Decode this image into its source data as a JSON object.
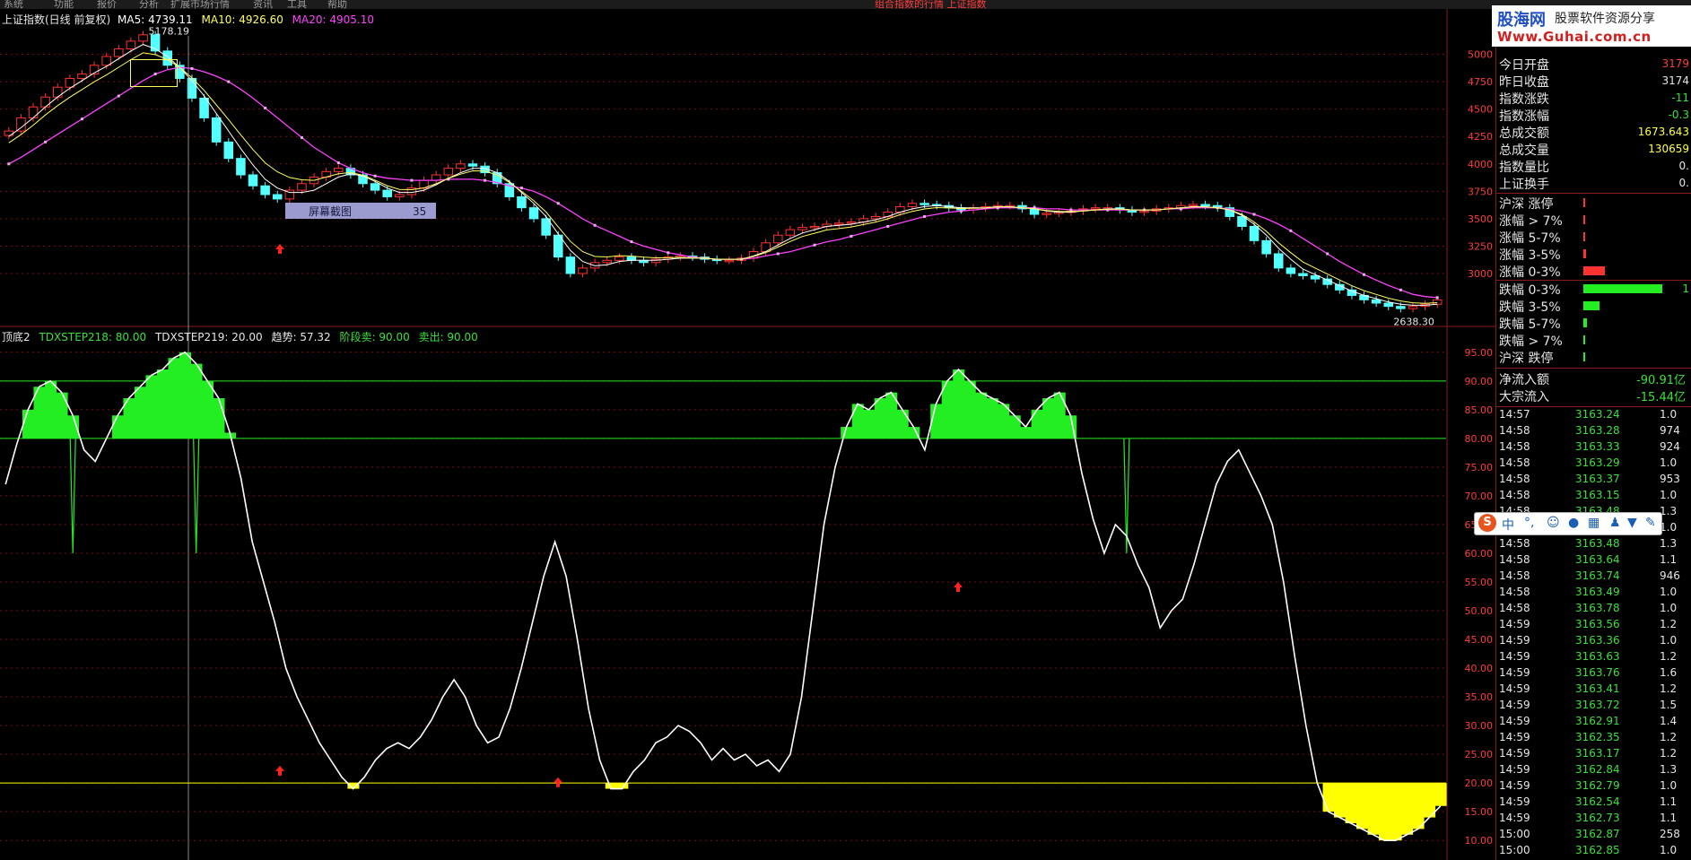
{
  "menu": [
    "系统",
    "功能",
    "报价",
    "分析",
    "扩展市场行情",
    "资讯",
    "工具",
    "帮助"
  ],
  "notice": "组合指数的行情   上证指数",
  "main_info": {
    "title": "上证指数(日线 前复权)",
    "ma5": "MA5: 4739.11",
    "ma10": "MA10: 4926.60",
    "ma20": "MA20: 4905.10",
    "high_label": "5178.19",
    "low_label": "2638.30",
    "overlay_text": "屏幕截图",
    "overlay_num": "35"
  },
  "sub_info": {
    "name": "顶底2",
    "s1": "TDXSTEP218: 80.00",
    "s2": "TDXSTEP219: 20.00",
    "s3": "趋势: 57.32",
    "s4": "阶段卖: 90.00",
    "s5": "卖出: 90.00"
  },
  "colors": {
    "up": "#ff3232",
    "down": "#54ffff",
    "ma5": "#ffffff",
    "ma10": "#ffff60",
    "ma20": "#ff40ff",
    "green": "#22ee22",
    "yellow": "#ffff00",
    "grid": "#7a0c0c"
  },
  "chart_data": [
    {
      "type": "line",
      "name": "上证指数 日线",
      "yticks": [
        3000,
        3250,
        3500,
        3750,
        4000,
        4250,
        4500,
        4750,
        5000
      ],
      "ylim": [
        2550,
        5250
      ],
      "series": [
        {
          "name": "close",
          "values": [
            4300,
            4420,
            4520,
            4610,
            4700,
            4780,
            4820,
            4900,
            4980,
            5050,
            5120,
            5178,
            5030,
            4900,
            4780,
            4600,
            4420,
            4200,
            4050,
            3900,
            3800,
            3720,
            3680,
            3760,
            3820,
            3880,
            3930,
            3960,
            3900,
            3820,
            3760,
            3700,
            3720,
            3780,
            3850,
            3900,
            3960,
            4000,
            3980,
            3920,
            3820,
            3700,
            3600,
            3500,
            3350,
            3150,
            3000,
            3050,
            3100,
            3120,
            3150,
            3120,
            3100,
            3130,
            3150,
            3160,
            3150,
            3130,
            3120,
            3120,
            3140,
            3200,
            3280,
            3350,
            3400,
            3420,
            3430,
            3450,
            3460,
            3470,
            3500,
            3520,
            3560,
            3610,
            3640,
            3630,
            3620,
            3600,
            3580,
            3600,
            3610,
            3620,
            3620,
            3590,
            3540,
            3550,
            3560,
            3570,
            3590,
            3600,
            3600,
            3580,
            3560,
            3570,
            3590,
            3600,
            3620,
            3630,
            3620,
            3600,
            3520,
            3430,
            3300,
            3180,
            3050,
            3000,
            2980,
            2950,
            2900,
            2850,
            2800,
            2760,
            2730,
            2700,
            2680,
            2700,
            2720,
            2760
          ]
        },
        {
          "name": "MA5",
          "values": [
            4250,
            4330,
            4420,
            4520,
            4610,
            4690,
            4760,
            4830,
            4890,
            4960,
            5030,
            5090,
            5050,
            4980,
            4880,
            4760,
            4620,
            4460,
            4300,
            4140,
            3990,
            3860,
            3780,
            3740,
            3740,
            3760,
            3820,
            3880,
            3910,
            3890,
            3840,
            3780,
            3740,
            3740,
            3760,
            3810,
            3870,
            3920,
            3960,
            3960,
            3920,
            3840,
            3740,
            3640,
            3520,
            3360,
            3210,
            3110,
            3070,
            3080,
            3110,
            3120,
            3120,
            3120,
            3130,
            3140,
            3140,
            3140,
            3130,
            3130,
            3130,
            3160,
            3200,
            3260,
            3320,
            3370,
            3400,
            3430,
            3440,
            3450,
            3470,
            3490,
            3520,
            3560,
            3590,
            3610,
            3620,
            3610,
            3600,
            3600,
            3600,
            3610,
            3610,
            3600,
            3590,
            3570,
            3560,
            3560,
            3570,
            3580,
            3590,
            3590,
            3580,
            3580,
            3580,
            3590,
            3600,
            3610,
            3610,
            3600,
            3580,
            3530,
            3450,
            3350,
            3230,
            3130,
            3040,
            2990,
            2940,
            2890,
            2840,
            2800,
            2770,
            2740,
            2720,
            2710,
            2710,
            2720
          ]
        },
        {
          "name": "MA20",
          "values": [
            4000,
            4060,
            4130,
            4200,
            4270,
            4340,
            4410,
            4480,
            4550,
            4620,
            4690,
            4760,
            4820,
            4860,
            4880,
            4870,
            4840,
            4800,
            4750,
            4680,
            4600,
            4510,
            4420,
            4330,
            4240,
            4150,
            4080,
            4010,
            3960,
            3920,
            3890,
            3870,
            3860,
            3850,
            3850,
            3850,
            3860,
            3860,
            3860,
            3850,
            3830,
            3800,
            3780,
            3750,
            3700,
            3640,
            3570,
            3500,
            3440,
            3390,
            3340,
            3290,
            3250,
            3220,
            3190,
            3170,
            3150,
            3140,
            3130,
            3130,
            3130,
            3140,
            3160,
            3180,
            3200,
            3230,
            3260,
            3290,
            3310,
            3340,
            3370,
            3400,
            3430,
            3460,
            3490,
            3520,
            3540,
            3560,
            3570,
            3580,
            3590,
            3600,
            3600,
            3600,
            3600,
            3590,
            3590,
            3580,
            3580,
            3580,
            3580,
            3580,
            3580,
            3580,
            3580,
            3590,
            3590,
            3600,
            3600,
            3600,
            3590,
            3570,
            3540,
            3500,
            3450,
            3390,
            3320,
            3250,
            3180,
            3110,
            3050,
            2990,
            2940,
            2890,
            2850,
            2810,
            2790,
            2780
          ]
        }
      ]
    },
    {
      "type": "area",
      "name": "顶底2",
      "yticks": [
        10,
        15,
        20,
        25,
        30,
        35,
        40,
        45,
        50,
        55,
        60,
        65,
        70,
        75,
        80,
        85,
        90,
        95
      ],
      "ylim": [
        8,
        97
      ],
      "reference_lines": [
        90,
        80,
        20
      ],
      "series": [
        {
          "name": "趋势",
          "values": [
            72,
            79,
            85,
            89,
            90,
            88,
            84,
            78,
            76,
            80,
            84,
            87,
            89,
            91,
            92,
            94,
            95,
            93,
            90,
            87,
            81,
            73,
            62,
            55,
            48,
            40,
            35,
            31,
            27,
            24,
            21,
            19,
            21,
            24,
            26,
            27,
            26,
            28,
            31,
            35,
            38,
            35,
            30,
            27,
            28,
            33,
            40,
            48,
            56,
            62,
            56,
            45,
            33,
            24,
            19,
            19,
            22,
            24,
            27,
            28,
            30,
            29,
            27,
            24,
            26,
            24,
            25,
            23,
            24,
            22,
            25,
            35,
            50,
            65,
            75,
            82,
            86,
            85,
            87,
            88,
            85,
            82,
            78,
            86,
            90,
            92,
            90,
            88,
            87,
            86,
            84,
            82,
            85,
            87,
            88,
            84,
            74,
            66,
            60,
            65,
            63,
            58,
            54,
            47,
            50,
            52,
            58,
            65,
            72,
            76,
            78,
            74,
            70,
            65,
            55,
            42,
            30,
            20,
            15,
            14,
            13,
            12,
            11,
            10,
            10,
            11,
            12,
            14,
            16
          ]
        },
        {
          "name": "阶段卖",
          "values": [
            90,
            90,
            88,
            90,
            90,
            90,
            90,
            90,
            90,
            90,
            90,
            90,
            90,
            90,
            90,
            90,
            90,
            90,
            90,
            90,
            90,
            90,
            90,
            90,
            90,
            90,
            90,
            90,
            90,
            90,
            90,
            90,
            90,
            90,
            90,
            90,
            90,
            90,
            90,
            90,
            90,
            90,
            90,
            90,
            90,
            90,
            90,
            90,
            90,
            90,
            90,
            90,
            90,
            90,
            90,
            90,
            90,
            90,
            90,
            90,
            90,
            90,
            90,
            90,
            90,
            90,
            90,
            90,
            90,
            90,
            90,
            90,
            90,
            90,
            90,
            90,
            90,
            90,
            90,
            90,
            90,
            90,
            90,
            90,
            90,
            90,
            90,
            90,
            90,
            90,
            90,
            90,
            90,
            90,
            90,
            90,
            90,
            90,
            90,
            90,
            90,
            90,
            90,
            90,
            90,
            90,
            90,
            90,
            90,
            90,
            90,
            90,
            90,
            90,
            90,
            90,
            90,
            90,
            90,
            90,
            90,
            90,
            90,
            90,
            90,
            90,
            90,
            90,
            90,
            90
          ]
        }
      ]
    }
  ],
  "panel": {
    "logo": {
      "site": "股海网",
      "tag": "股票软件资源分享",
      "url": "Www.Guhai.com.cn"
    },
    "stats": [
      {
        "label": "今日开盘",
        "value": "3179",
        "color": "#ff3c3c"
      },
      {
        "label": "昨日收盘",
        "value": "3174",
        "color": "#e6e6e6"
      },
      {
        "label": "指数涨跌",
        "value": "-11",
        "color": "#3ae03a"
      },
      {
        "label": "指数涨幅",
        "value": "-0.3",
        "color": "#3ae03a"
      },
      {
        "label": "总成交额",
        "value": "1673.643",
        "color": "#ffff40"
      },
      {
        "label": "总成交量",
        "value": "130659",
        "color": "#ffff40"
      },
      {
        "label": "指数量比",
        "value": "0.",
        "color": "#e6e6e6"
      },
      {
        "label": "上证换手",
        "value": "0.",
        "color": "#e6e6e6"
      }
    ],
    "breadth": [
      {
        "label": "沪深 涨停",
        "value": ""
      },
      {
        "label": "涨幅 > 7%",
        "value": ""
      },
      {
        "label": "涨幅 5-7%",
        "value": ""
      },
      {
        "label": "涨幅 3-5%",
        "value": ""
      },
      {
        "label": "涨幅 0-3%",
        "value": ""
      },
      {
        "label": "跌幅 0-3%",
        "value": "1"
      },
      {
        "label": "跌幅 3-5%",
        "value": ""
      },
      {
        "label": "跌幅 5-7%",
        "value": ""
      },
      {
        "label": "跌幅 > 7%",
        "value": ""
      },
      {
        "label": "沪深 跌停",
        "value": ""
      }
    ],
    "breadth_levels": [
      0.005,
      0.01,
      0.015,
      0.03,
      0.27,
      1.0,
      0.2,
      0.05,
      0.01,
      0.005
    ],
    "flows": [
      {
        "label": "净流入额",
        "value": "-90.91亿"
      },
      {
        "label": "大宗流入",
        "value": "-15.44亿"
      }
    ],
    "ticks": [
      [
        "14:57",
        "3163.24",
        "1.0"
      ],
      [
        "14:58",
        "3163.28",
        "974"
      ],
      [
        "14:58",
        "3163.33",
        "924"
      ],
      [
        "14:58",
        "3163.29",
        "1.0"
      ],
      [
        "14:58",
        "3163.37",
        "953"
      ],
      [
        "14:58",
        "3163.15",
        "1.0"
      ],
      [
        "14:58",
        "3163.48",
        "1.3"
      ],
      [
        "14:58",
        "3163.52",
        "1.0"
      ],
      [
        "14:58",
        "3163.48",
        "1.3"
      ],
      [
        "14:58",
        "3163.64",
        "1.1"
      ],
      [
        "14:58",
        "3163.74",
        "946"
      ],
      [
        "14:58",
        "3163.49",
        "1.0"
      ],
      [
        "14:58",
        "3163.78",
        "1.0"
      ],
      [
        "14:59",
        "3163.56",
        "1.2"
      ],
      [
        "14:59",
        "3163.36",
        "1.0"
      ],
      [
        "14:59",
        "3163.63",
        "1.2"
      ],
      [
        "14:59",
        "3163.76",
        "1.6"
      ],
      [
        "14:59",
        "3163.41",
        "1.2"
      ],
      [
        "14:59",
        "3163.72",
        "1.5"
      ],
      [
        "14:59",
        "3162.91",
        "1.4"
      ],
      [
        "14:59",
        "3162.35",
        "1.2"
      ],
      [
        "14:59",
        "3163.17",
        "1.2"
      ],
      [
        "14:59",
        "3162.84",
        "1.3"
      ],
      [
        "14:59",
        "3162.79",
        "1.0"
      ],
      [
        "14:59",
        "3162.54",
        "1.1"
      ],
      [
        "14:59",
        "3162.73",
        "1.1"
      ],
      [
        "15:00",
        "3162.87",
        "258"
      ],
      [
        "15:00",
        "3162.85",
        "1.0"
      ]
    ]
  },
  "ime": {
    "label": "中"
  }
}
